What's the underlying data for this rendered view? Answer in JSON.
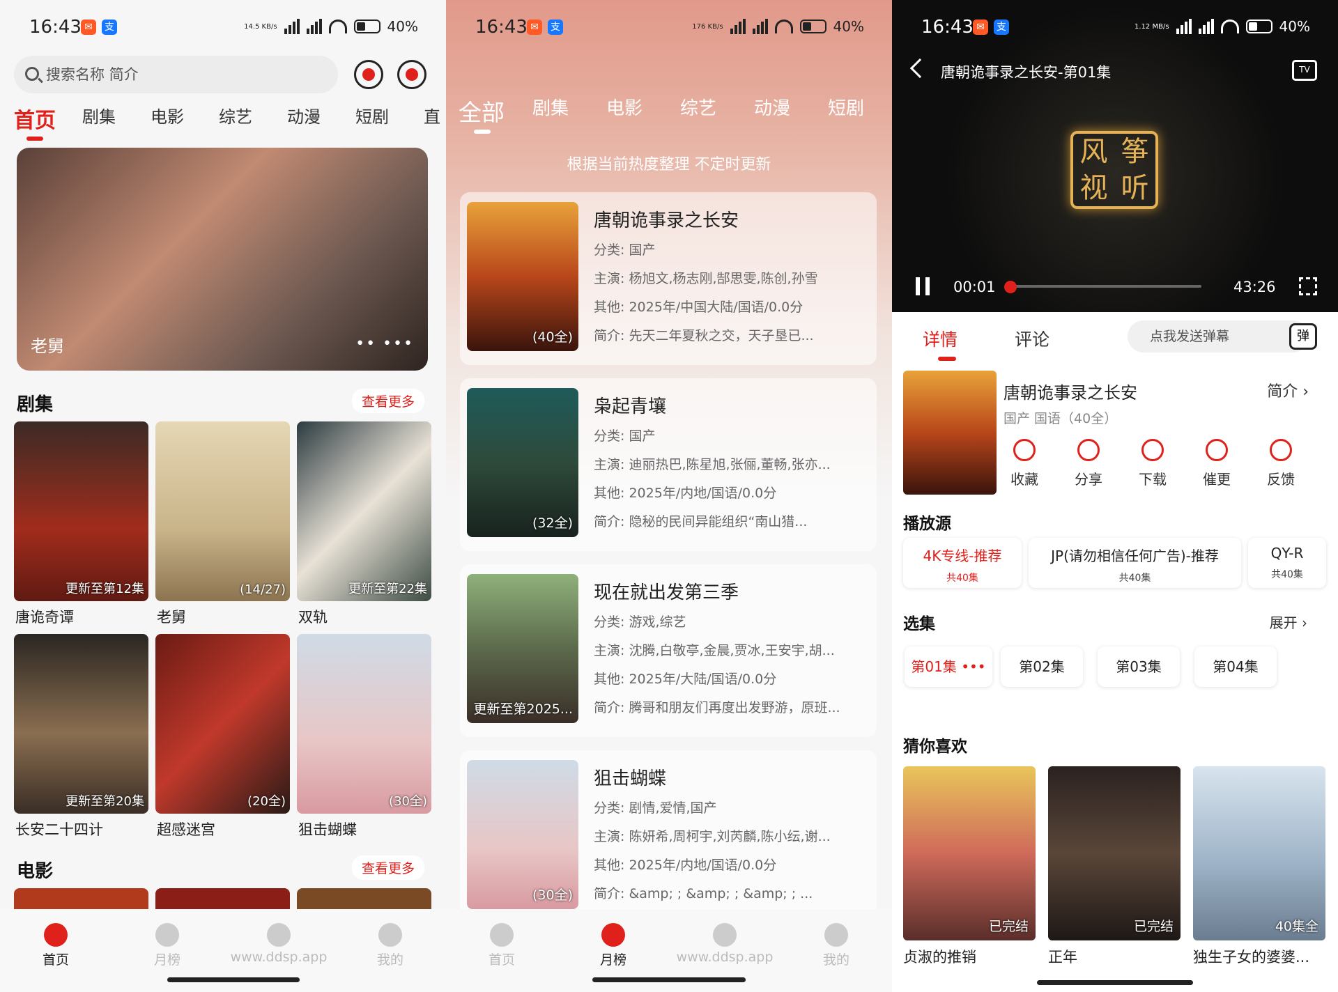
{
  "colors": {
    "accent": "#e0201b",
    "app_badge_1": "#ff5a26",
    "app_badge_2": "#1677ff"
  },
  "status": {
    "time": "16:43",
    "p1_rate": "14.5 KB/s",
    "p2_rate": "176 KB/s",
    "p3_rate": "1.12 MB/s",
    "battery": "40%",
    "net": "4G"
  },
  "p1": {
    "search_placeholder": "搜索名称 简介",
    "tabs": [
      "首页",
      "剧集",
      "电影",
      "综艺",
      "动漫",
      "短剧",
      "直"
    ],
    "banner": {
      "label": "老舅",
      "dots": "••  •••"
    },
    "section_drama": "剧集",
    "section_movie": "电影",
    "more": "查看更多",
    "dramas": [
      {
        "title": "唐诡奇谭",
        "cap": "更新至第12集"
      },
      {
        "title": "老舅",
        "cap": "(14/27)"
      },
      {
        "title": "双轨",
        "cap": "更新至第22集"
      },
      {
        "title": "长安二十四计",
        "cap": "更新至第20集"
      },
      {
        "title": "超感迷宫",
        "cap": "(20全)"
      },
      {
        "title": "狙击蝴蝶",
        "cap": "(30全)"
      }
    ]
  },
  "bottom_nav": [
    "首页",
    "月榜",
    "www.ddsp.app",
    "我的"
  ],
  "p2": {
    "tabs": [
      "全部",
      "剧集",
      "电影",
      "综艺",
      "动漫",
      "短剧"
    ],
    "subtitle": "根据当前热度整理 不定时更新",
    "cards": [
      {
        "title": "唐朝诡事录之长安",
        "cat": "分类: 国产",
        "cast": "主演: 杨旭文,杨志刚,郜思雯,陈创,孙雪",
        "other": "其他: 2025年/中国大陆/国语/0.0分",
        "intro": "简介:      先天二年夏秋之交，天子垦已...",
        "cap": "(40全)"
      },
      {
        "title": "枭起青壤",
        "cat": "分类: 国产",
        "cast": "主演: 迪丽热巴,陈星旭,张俪,董畅,张亦...",
        "other": "其他: 2025年/内地/国语/0.0分",
        "intro": "简介:      隐秘的民间异能组织“南山猎...",
        "cap": "(32全)"
      },
      {
        "title": "现在就出发第三季",
        "cat": "分类: 游戏,综艺",
        "cast": "主演: 沈腾,白敬亭,金晨,贾冰,王安宇,胡...",
        "other": "其他: 2025年/大陆/国语/0.0分",
        "intro": "简介: 腾哥和朋友们再度出发野游，原班...",
        "cap": "更新至第2025..."
      },
      {
        "title": "狙击蝴蝶",
        "cat": "分类: 剧情,爱情,国产",
        "cast": "主演: 陈妍希,周柯宇,刘芮麟,陈小纭,谢...",
        "other": "其他: 2025年/内地/国语/0.0分",
        "intro": "简介: &amp;    ; &amp;    ; &amp;    ; ...",
        "cap": "(30全)"
      }
    ]
  },
  "p3": {
    "video_title": "唐朝诡事录之长安-第01集",
    "tv_label": "TV",
    "logo_chars": [
      "风",
      "筝",
      "视",
      "听"
    ],
    "time_current": "00:01",
    "time_total": "43:26",
    "progress": 0.0004,
    "tabs": [
      "详情",
      "评论"
    ],
    "danmu_placeholder": "点我发送弹幕",
    "danmu_icon": "弹",
    "title": "唐朝诡事录之长安",
    "meta": "国产 国语（40全）",
    "brief": "简介 ›",
    "actions": [
      "收藏",
      "分享",
      "下载",
      "催更",
      "反馈"
    ],
    "source_label": "播放源",
    "sources": [
      {
        "name": "4K专线-推荐",
        "count": "共40集"
      },
      {
        "name": "JP(请勿相信任何广告)-推荐",
        "count": "共40集"
      },
      {
        "name": "QY-R",
        "count": "共40集"
      }
    ],
    "episodes_label": "选集",
    "expand": "展开 ›",
    "episodes": [
      "第01集 •••",
      "第02集",
      "第03集",
      "第04集"
    ],
    "recommend_label": "猜你喜欢",
    "recommend": [
      {
        "title": "贞淑的推销",
        "cap": "已完结"
      },
      {
        "title": "正年",
        "cap": "已完结"
      },
      {
        "title": "独生子女的婆婆...",
        "cap": "40集全"
      }
    ]
  }
}
